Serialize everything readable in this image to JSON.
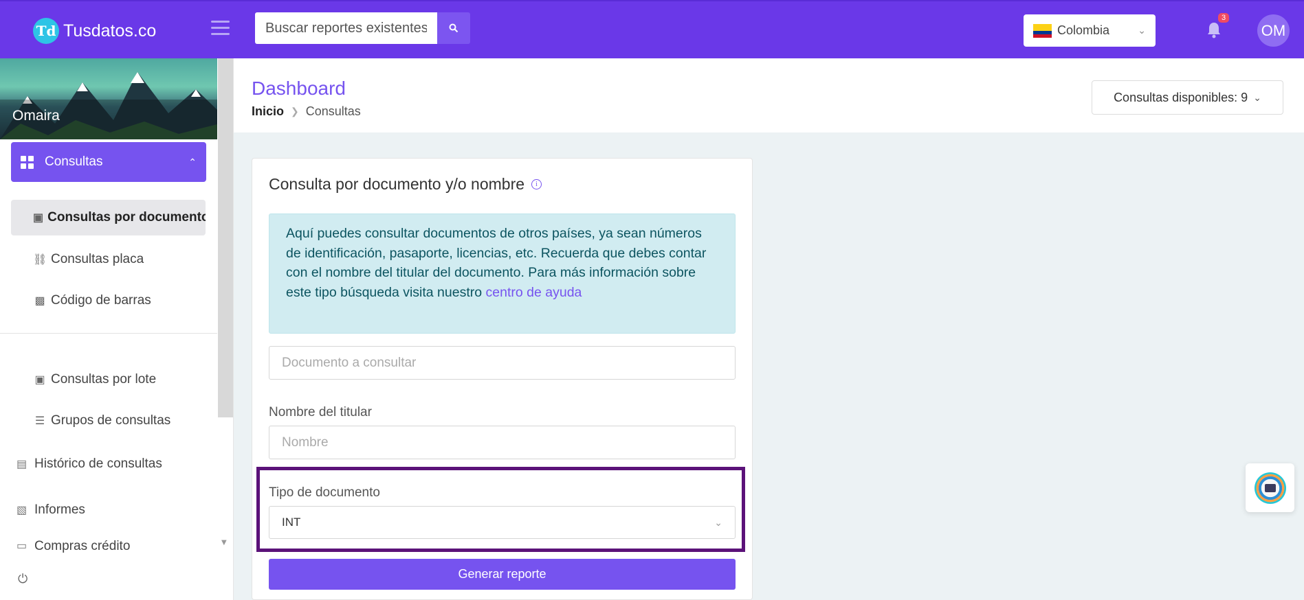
{
  "app": {
    "logo_mark": "Td",
    "name": "Tusdatos.co"
  },
  "header": {
    "search_placeholder": "Buscar reportes existentes",
    "country": "Colombia",
    "notifications_count": "3",
    "avatar_initials": "OM"
  },
  "sidebar": {
    "user_name": "Omaira",
    "active_section": "Consultas",
    "sub_items": [
      {
        "label": "Consultas por documento",
        "icon": "id-card-icon"
      },
      {
        "label": "Consultas placa",
        "icon": "car-icon"
      },
      {
        "label": "Código de barras",
        "icon": "barcode-icon"
      },
      {
        "label": "Consultas por lote",
        "icon": "id-card-icon"
      },
      {
        "label": "Grupos de consultas",
        "icon": "layers-icon"
      }
    ],
    "nav_items": [
      {
        "label": "Histórico de consultas",
        "icon": "clipboard-icon"
      },
      {
        "label": "Informes",
        "icon": "file-chart-icon"
      },
      {
        "label": "Compras crédito",
        "icon": "card-icon"
      }
    ]
  },
  "page": {
    "title": "Dashboard",
    "breadcrumb_home": "Inicio",
    "breadcrumb_current": "Consultas",
    "credits": "Consultas disponibles: 9"
  },
  "card": {
    "title": "Consulta por documento y/o nombre",
    "alert_text": "Aquí puedes consultar documentos de otros países, ya sean números de identificación, pasaporte, licencias, etc. Recuerda que debes contar con el nombre del titular del documento. Para más información sobre este tipo búsqueda visita nuestro ",
    "alert_link": "centro de ayuda",
    "document_placeholder": "Documento a consultar",
    "holder_label": "Nombre del titular",
    "holder_placeholder": "Nombre",
    "doc_type_label": "Tipo de documento",
    "doc_type_value": "INT",
    "submit_label": "Generar reporte"
  },
  "colors": {
    "topbar": "#6a38e8",
    "accent": "#7653ef",
    "highlight_border": "#5b1279",
    "alert_bg": "#d1ecf1"
  }
}
